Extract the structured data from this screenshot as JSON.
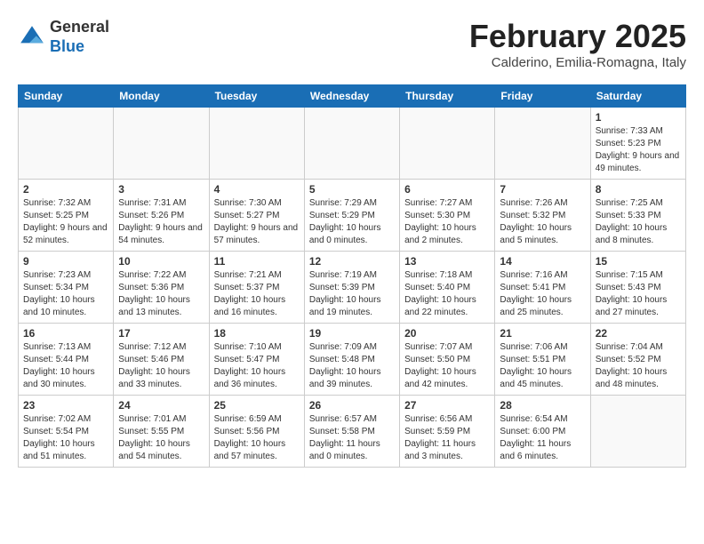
{
  "logo": {
    "line1": "General",
    "line2": "Blue"
  },
  "title": "February 2025",
  "location": "Calderino, Emilia-Romagna, Italy",
  "weekdays": [
    "Sunday",
    "Monday",
    "Tuesday",
    "Wednesday",
    "Thursday",
    "Friday",
    "Saturday"
  ],
  "weeks": [
    [
      {
        "day": "",
        "info": ""
      },
      {
        "day": "",
        "info": ""
      },
      {
        "day": "",
        "info": ""
      },
      {
        "day": "",
        "info": ""
      },
      {
        "day": "",
        "info": ""
      },
      {
        "day": "",
        "info": ""
      },
      {
        "day": "1",
        "info": "Sunrise: 7:33 AM\nSunset: 5:23 PM\nDaylight: 9 hours and 49 minutes."
      }
    ],
    [
      {
        "day": "2",
        "info": "Sunrise: 7:32 AM\nSunset: 5:25 PM\nDaylight: 9 hours and 52 minutes."
      },
      {
        "day": "3",
        "info": "Sunrise: 7:31 AM\nSunset: 5:26 PM\nDaylight: 9 hours and 54 minutes."
      },
      {
        "day": "4",
        "info": "Sunrise: 7:30 AM\nSunset: 5:27 PM\nDaylight: 9 hours and 57 minutes."
      },
      {
        "day": "5",
        "info": "Sunrise: 7:29 AM\nSunset: 5:29 PM\nDaylight: 10 hours and 0 minutes."
      },
      {
        "day": "6",
        "info": "Sunrise: 7:27 AM\nSunset: 5:30 PM\nDaylight: 10 hours and 2 minutes."
      },
      {
        "day": "7",
        "info": "Sunrise: 7:26 AM\nSunset: 5:32 PM\nDaylight: 10 hours and 5 minutes."
      },
      {
        "day": "8",
        "info": "Sunrise: 7:25 AM\nSunset: 5:33 PM\nDaylight: 10 hours and 8 minutes."
      }
    ],
    [
      {
        "day": "9",
        "info": "Sunrise: 7:23 AM\nSunset: 5:34 PM\nDaylight: 10 hours and 10 minutes."
      },
      {
        "day": "10",
        "info": "Sunrise: 7:22 AM\nSunset: 5:36 PM\nDaylight: 10 hours and 13 minutes."
      },
      {
        "day": "11",
        "info": "Sunrise: 7:21 AM\nSunset: 5:37 PM\nDaylight: 10 hours and 16 minutes."
      },
      {
        "day": "12",
        "info": "Sunrise: 7:19 AM\nSunset: 5:39 PM\nDaylight: 10 hours and 19 minutes."
      },
      {
        "day": "13",
        "info": "Sunrise: 7:18 AM\nSunset: 5:40 PM\nDaylight: 10 hours and 22 minutes."
      },
      {
        "day": "14",
        "info": "Sunrise: 7:16 AM\nSunset: 5:41 PM\nDaylight: 10 hours and 25 minutes."
      },
      {
        "day": "15",
        "info": "Sunrise: 7:15 AM\nSunset: 5:43 PM\nDaylight: 10 hours and 27 minutes."
      }
    ],
    [
      {
        "day": "16",
        "info": "Sunrise: 7:13 AM\nSunset: 5:44 PM\nDaylight: 10 hours and 30 minutes."
      },
      {
        "day": "17",
        "info": "Sunrise: 7:12 AM\nSunset: 5:46 PM\nDaylight: 10 hours and 33 minutes."
      },
      {
        "day": "18",
        "info": "Sunrise: 7:10 AM\nSunset: 5:47 PM\nDaylight: 10 hours and 36 minutes."
      },
      {
        "day": "19",
        "info": "Sunrise: 7:09 AM\nSunset: 5:48 PM\nDaylight: 10 hours and 39 minutes."
      },
      {
        "day": "20",
        "info": "Sunrise: 7:07 AM\nSunset: 5:50 PM\nDaylight: 10 hours and 42 minutes."
      },
      {
        "day": "21",
        "info": "Sunrise: 7:06 AM\nSunset: 5:51 PM\nDaylight: 10 hours and 45 minutes."
      },
      {
        "day": "22",
        "info": "Sunrise: 7:04 AM\nSunset: 5:52 PM\nDaylight: 10 hours and 48 minutes."
      }
    ],
    [
      {
        "day": "23",
        "info": "Sunrise: 7:02 AM\nSunset: 5:54 PM\nDaylight: 10 hours and 51 minutes."
      },
      {
        "day": "24",
        "info": "Sunrise: 7:01 AM\nSunset: 5:55 PM\nDaylight: 10 hours and 54 minutes."
      },
      {
        "day": "25",
        "info": "Sunrise: 6:59 AM\nSunset: 5:56 PM\nDaylight: 10 hours and 57 minutes."
      },
      {
        "day": "26",
        "info": "Sunrise: 6:57 AM\nSunset: 5:58 PM\nDaylight: 11 hours and 0 minutes."
      },
      {
        "day": "27",
        "info": "Sunrise: 6:56 AM\nSunset: 5:59 PM\nDaylight: 11 hours and 3 minutes."
      },
      {
        "day": "28",
        "info": "Sunrise: 6:54 AM\nSunset: 6:00 PM\nDaylight: 11 hours and 6 minutes."
      },
      {
        "day": "",
        "info": ""
      }
    ]
  ]
}
